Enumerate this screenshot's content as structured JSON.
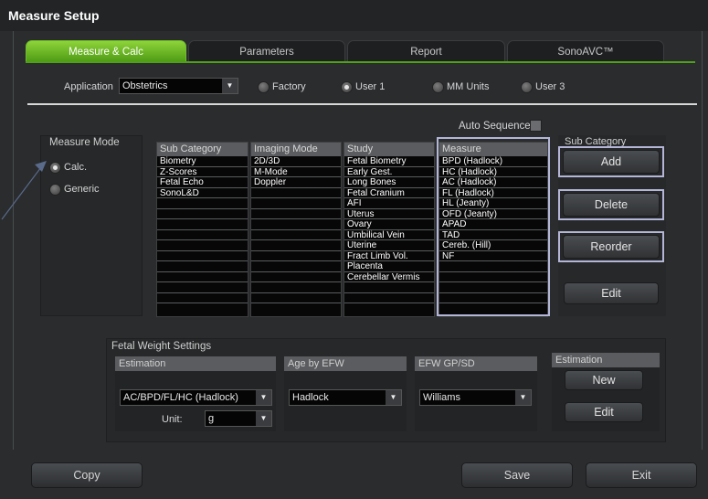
{
  "window": {
    "title": "Measure Setup"
  },
  "tabs": [
    {
      "label": "Measure & Calc",
      "active": true
    },
    {
      "label": "Parameters",
      "active": false
    },
    {
      "label": "Report",
      "active": false
    },
    {
      "label": "SonoAVC™",
      "active": false
    }
  ],
  "application": {
    "label": "Application",
    "value": "Obstetrics",
    "radios": [
      {
        "label": "Factory",
        "selected": false
      },
      {
        "label": "User 1",
        "selected": true
      },
      {
        "label": "MM Units",
        "selected": false
      },
      {
        "label": "User 3",
        "selected": false
      }
    ]
  },
  "auto_sequence": {
    "label": "Auto Sequence",
    "checked": false
  },
  "measure_mode": {
    "title": "Measure Mode",
    "options": [
      {
        "label": "Calc.",
        "selected": true
      },
      {
        "label": "Generic",
        "selected": false
      }
    ]
  },
  "grid": {
    "columns": [
      {
        "header": "Sub Category",
        "rows": [
          "Biometry",
          "Z-Scores",
          "Fetal Echo",
          "SonoL&D",
          "",
          "",
          "",
          "",
          "",
          "",
          "",
          "",
          "",
          ""
        ]
      },
      {
        "header": "Imaging Mode",
        "rows": [
          "2D/3D",
          "M-Mode",
          "Doppler",
          "",
          "",
          "",
          "",
          "",
          "",
          "",
          "",
          "",
          "",
          ""
        ]
      },
      {
        "header": "Study",
        "rows": [
          "Fetal Biometry",
          "Early Gest.",
          "Long Bones",
          "Fetal Cranium",
          "AFI",
          "Uterus",
          "Ovary",
          "Umbilical Vein",
          "Uterine",
          "Fract Limb Vol.",
          "Placenta",
          "Cerebellar Vermis",
          "",
          ""
        ]
      },
      {
        "header": "Measure",
        "rows": [
          "BPD (Hadlock)",
          "HC (Hadlock)",
          "AC (Hadlock)",
          "FL (Hadlock)",
          "HL (Jeanty)",
          "OFD (Jeanty)",
          "APAD",
          "TAD",
          "Cereb. (Hill)",
          "NF",
          "",
          "",
          "",
          ""
        ]
      }
    ]
  },
  "sub_category": {
    "title": "Sub Category",
    "add_label": "Add",
    "delete_label": "Delete",
    "reorder_label": "Reorder",
    "edit_label": "Edit"
  },
  "fetal_weight": {
    "title": "Fetal Weight Settings",
    "estimation": {
      "header": "Estimation",
      "value": "AC/BPD/FL/HC (Hadlock)",
      "unit_label": "Unit:",
      "unit_value": "g"
    },
    "age_by_efw": {
      "header": "Age by EFW",
      "value": "Hadlock"
    },
    "efw_gp_sd": {
      "header": "EFW GP/SD",
      "value": "Williams"
    },
    "estimation_box": {
      "title": "Estimation",
      "new_label": "New",
      "edit_label": "Edit"
    }
  },
  "footer": {
    "copy_label": "Copy",
    "save_label": "Save",
    "exit_label": "Exit"
  },
  "colors": {
    "accent": "#5aa81a",
    "highlight": "#b4b6d8",
    "background": "#2a2c2e"
  },
  "icons": {
    "dropdown": "chevron-down-icon",
    "annotation_arrow": "pointer-arrow-icon"
  }
}
